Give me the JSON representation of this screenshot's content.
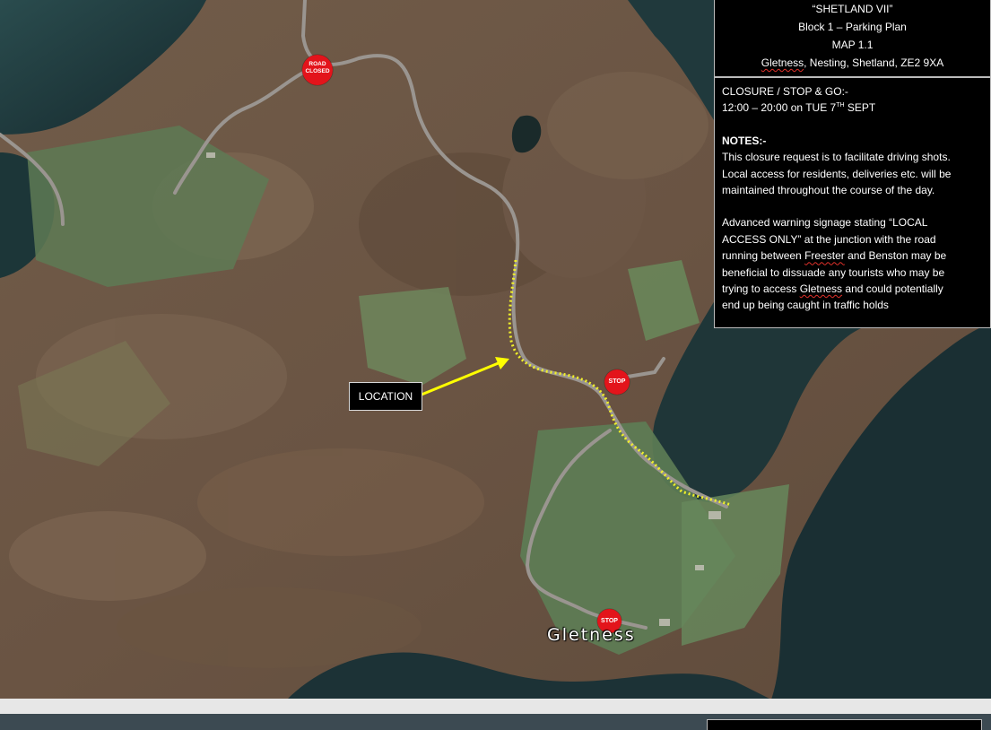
{
  "title_box": {
    "line1": "“SHETLAND VII”",
    "line2": "Block 1 – Parking Plan",
    "line3": "MAP 1.1",
    "address_place": "Gletness",
    "address_rest": ", Nesting, Shetland, ZE2 9XA"
  },
  "notes_box": {
    "closure_heading": "CLOSURE / STOP & GO:-",
    "closure_time_prefix": "12:00 – 20:00 on TUE 7",
    "closure_time_sup": "TH",
    "closure_time_suffix": " SEPT",
    "notes_heading": "NOTES:-",
    "para1_line1": "This closure request is to facilitate driving shots.",
    "para1_line2": "Local access for residents, deliveries etc. will be",
    "para1_line3": "maintained throughout the course of the day.",
    "para2_line1": "Advanced warning signage stating “LOCAL",
    "para2_line2": "ACCESS ONLY” at the junction with the road",
    "para2_line3a": "running between ",
    "para2_line3b": "Freester",
    "para2_line3c": " and Benston may be",
    "para2_line4": "beneficial to dissuade any tourists who may be",
    "para2_line5a": "trying to access ",
    "para2_line5b": "Gletness",
    "para2_line5c": " and could potentially",
    "para2_line6": "end up being caught in traffic holds"
  },
  "location_label": "LOCATION",
  "signs": {
    "road_closed_line1": "ROAD",
    "road_closed_line2": "CLOSED",
    "stop1": "STOP",
    "stop2": "STOP"
  },
  "place_label": "Gletness",
  "colors": {
    "sign_red": "#e3141b",
    "route_yellow": "#f0f02a",
    "arrow_yellow": "#ffff00",
    "panel_black": "#000000",
    "sea": "#1f3b3e",
    "land_brown": "#6b5644",
    "grass_green": "#5d7a52"
  }
}
